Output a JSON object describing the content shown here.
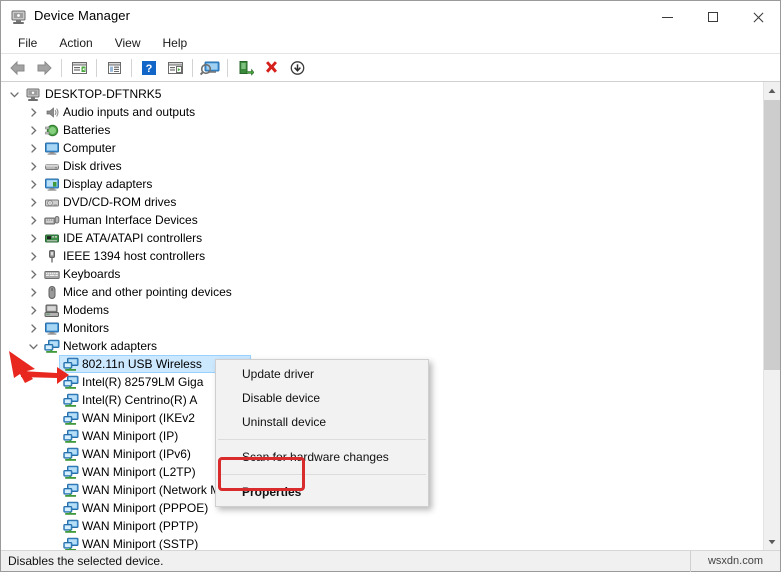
{
  "window": {
    "title": "Device Manager",
    "icon": "device-manager-icon",
    "controls": {
      "minimize": "–",
      "maximize": "□",
      "close": "✕"
    }
  },
  "menubar": {
    "items": [
      "File",
      "Action",
      "View",
      "Help"
    ]
  },
  "toolbar": {
    "buttons": [
      {
        "name": "back-icon",
        "title": "Back"
      },
      {
        "name": "forward-icon",
        "title": "Forward"
      },
      {
        "name": "separator",
        "title": ""
      },
      {
        "name": "properties-icon",
        "title": "Properties"
      },
      {
        "name": "separator",
        "title": ""
      },
      {
        "name": "view-details-icon",
        "title": "View"
      },
      {
        "name": "separator",
        "title": ""
      },
      {
        "name": "help-icon",
        "title": "Help"
      },
      {
        "name": "update-driver-icon",
        "title": "Update driver"
      },
      {
        "name": "separator",
        "title": ""
      },
      {
        "name": "scan-hardware-icon",
        "title": "Scan for hardware changes"
      },
      {
        "name": "separator",
        "title": ""
      },
      {
        "name": "enable-device-icon",
        "title": "Enable device"
      },
      {
        "name": "uninstall-device-icon",
        "title": "Uninstall device"
      },
      {
        "name": "disable-device-icon",
        "title": "Disable device"
      }
    ]
  },
  "tree": {
    "root": {
      "label": "DESKTOP-DFTNRK5",
      "icon": "computer-icon",
      "expanded": true
    },
    "categories": [
      {
        "label": "Audio inputs and outputs",
        "icon": "speaker-icon",
        "expanded": false
      },
      {
        "label": "Batteries",
        "icon": "battery-icon",
        "expanded": false
      },
      {
        "label": "Computer",
        "icon": "monitor-icon",
        "expanded": false
      },
      {
        "label": "Disk drives",
        "icon": "disk-icon",
        "expanded": false
      },
      {
        "label": "Display adapters",
        "icon": "display-adapter-icon",
        "expanded": false
      },
      {
        "label": "DVD/CD-ROM drives",
        "icon": "dvd-icon",
        "expanded": false
      },
      {
        "label": "Human Interface Devices",
        "icon": "hid-icon",
        "expanded": false
      },
      {
        "label": "IDE ATA/ATAPI controllers",
        "icon": "ide-icon",
        "expanded": false
      },
      {
        "label": "IEEE 1394 host controllers",
        "icon": "ieee1394-icon",
        "expanded": false
      },
      {
        "label": "Keyboards",
        "icon": "keyboard-icon",
        "expanded": false
      },
      {
        "label": "Mice and other pointing devices",
        "icon": "mouse-icon",
        "expanded": false
      },
      {
        "label": "Modems",
        "icon": "modem-icon",
        "expanded": false
      },
      {
        "label": "Monitors",
        "icon": "monitor-icon",
        "expanded": false
      },
      {
        "label": "Network adapters",
        "icon": "network-adapter-icon",
        "expanded": true
      }
    ],
    "network_devices": [
      {
        "label": "802.11n USB Wireless",
        "icon": "network-adapter-icon",
        "selected": true
      },
      {
        "label": "Intel(R) 82579LM Giga",
        "icon": "network-adapter-icon",
        "selected": false
      },
      {
        "label": "Intel(R) Centrino(R) A",
        "icon": "network-adapter-icon",
        "selected": false
      },
      {
        "label": "WAN Miniport (IKEv2",
        "icon": "network-adapter-icon",
        "selected": false
      },
      {
        "label": "WAN Miniport (IP)",
        "icon": "network-adapter-icon",
        "selected": false
      },
      {
        "label": "WAN Miniport (IPv6)",
        "icon": "network-adapter-icon",
        "selected": false
      },
      {
        "label": "WAN Miniport (L2TP)",
        "icon": "network-adapter-icon",
        "selected": false
      },
      {
        "label": "WAN Miniport (Network Monitor)",
        "icon": "network-adapter-icon",
        "selected": false
      },
      {
        "label": "WAN Miniport (PPPOE)",
        "icon": "network-adapter-icon",
        "selected": false
      },
      {
        "label": "WAN Miniport (PPTP)",
        "icon": "network-adapter-icon",
        "selected": false
      },
      {
        "label": "WAN Miniport (SSTP)",
        "icon": "network-adapter-icon",
        "selected": false
      }
    ]
  },
  "context_menu": {
    "items": [
      {
        "label": "Update driver",
        "bold": false,
        "separator_after": false
      },
      {
        "label": "Disable device",
        "bold": false,
        "separator_after": false
      },
      {
        "label": "Uninstall device",
        "bold": false,
        "separator_after": true
      },
      {
        "label": "Scan for hardware changes",
        "bold": false,
        "separator_after": true
      },
      {
        "label": "Properties",
        "bold": true,
        "separator_after": false
      }
    ]
  },
  "annotations": {
    "highlight_color": "#d92b2b",
    "arrow_color": "#e8271f",
    "highlighted_item": "Properties",
    "arrow_points_to": "802.11n USB Wireless"
  },
  "statusbar": {
    "message": "Disables the selected device.",
    "brand": "wsxdn.com"
  },
  "scrollbar": {
    "up": "▲",
    "down": "▼"
  }
}
